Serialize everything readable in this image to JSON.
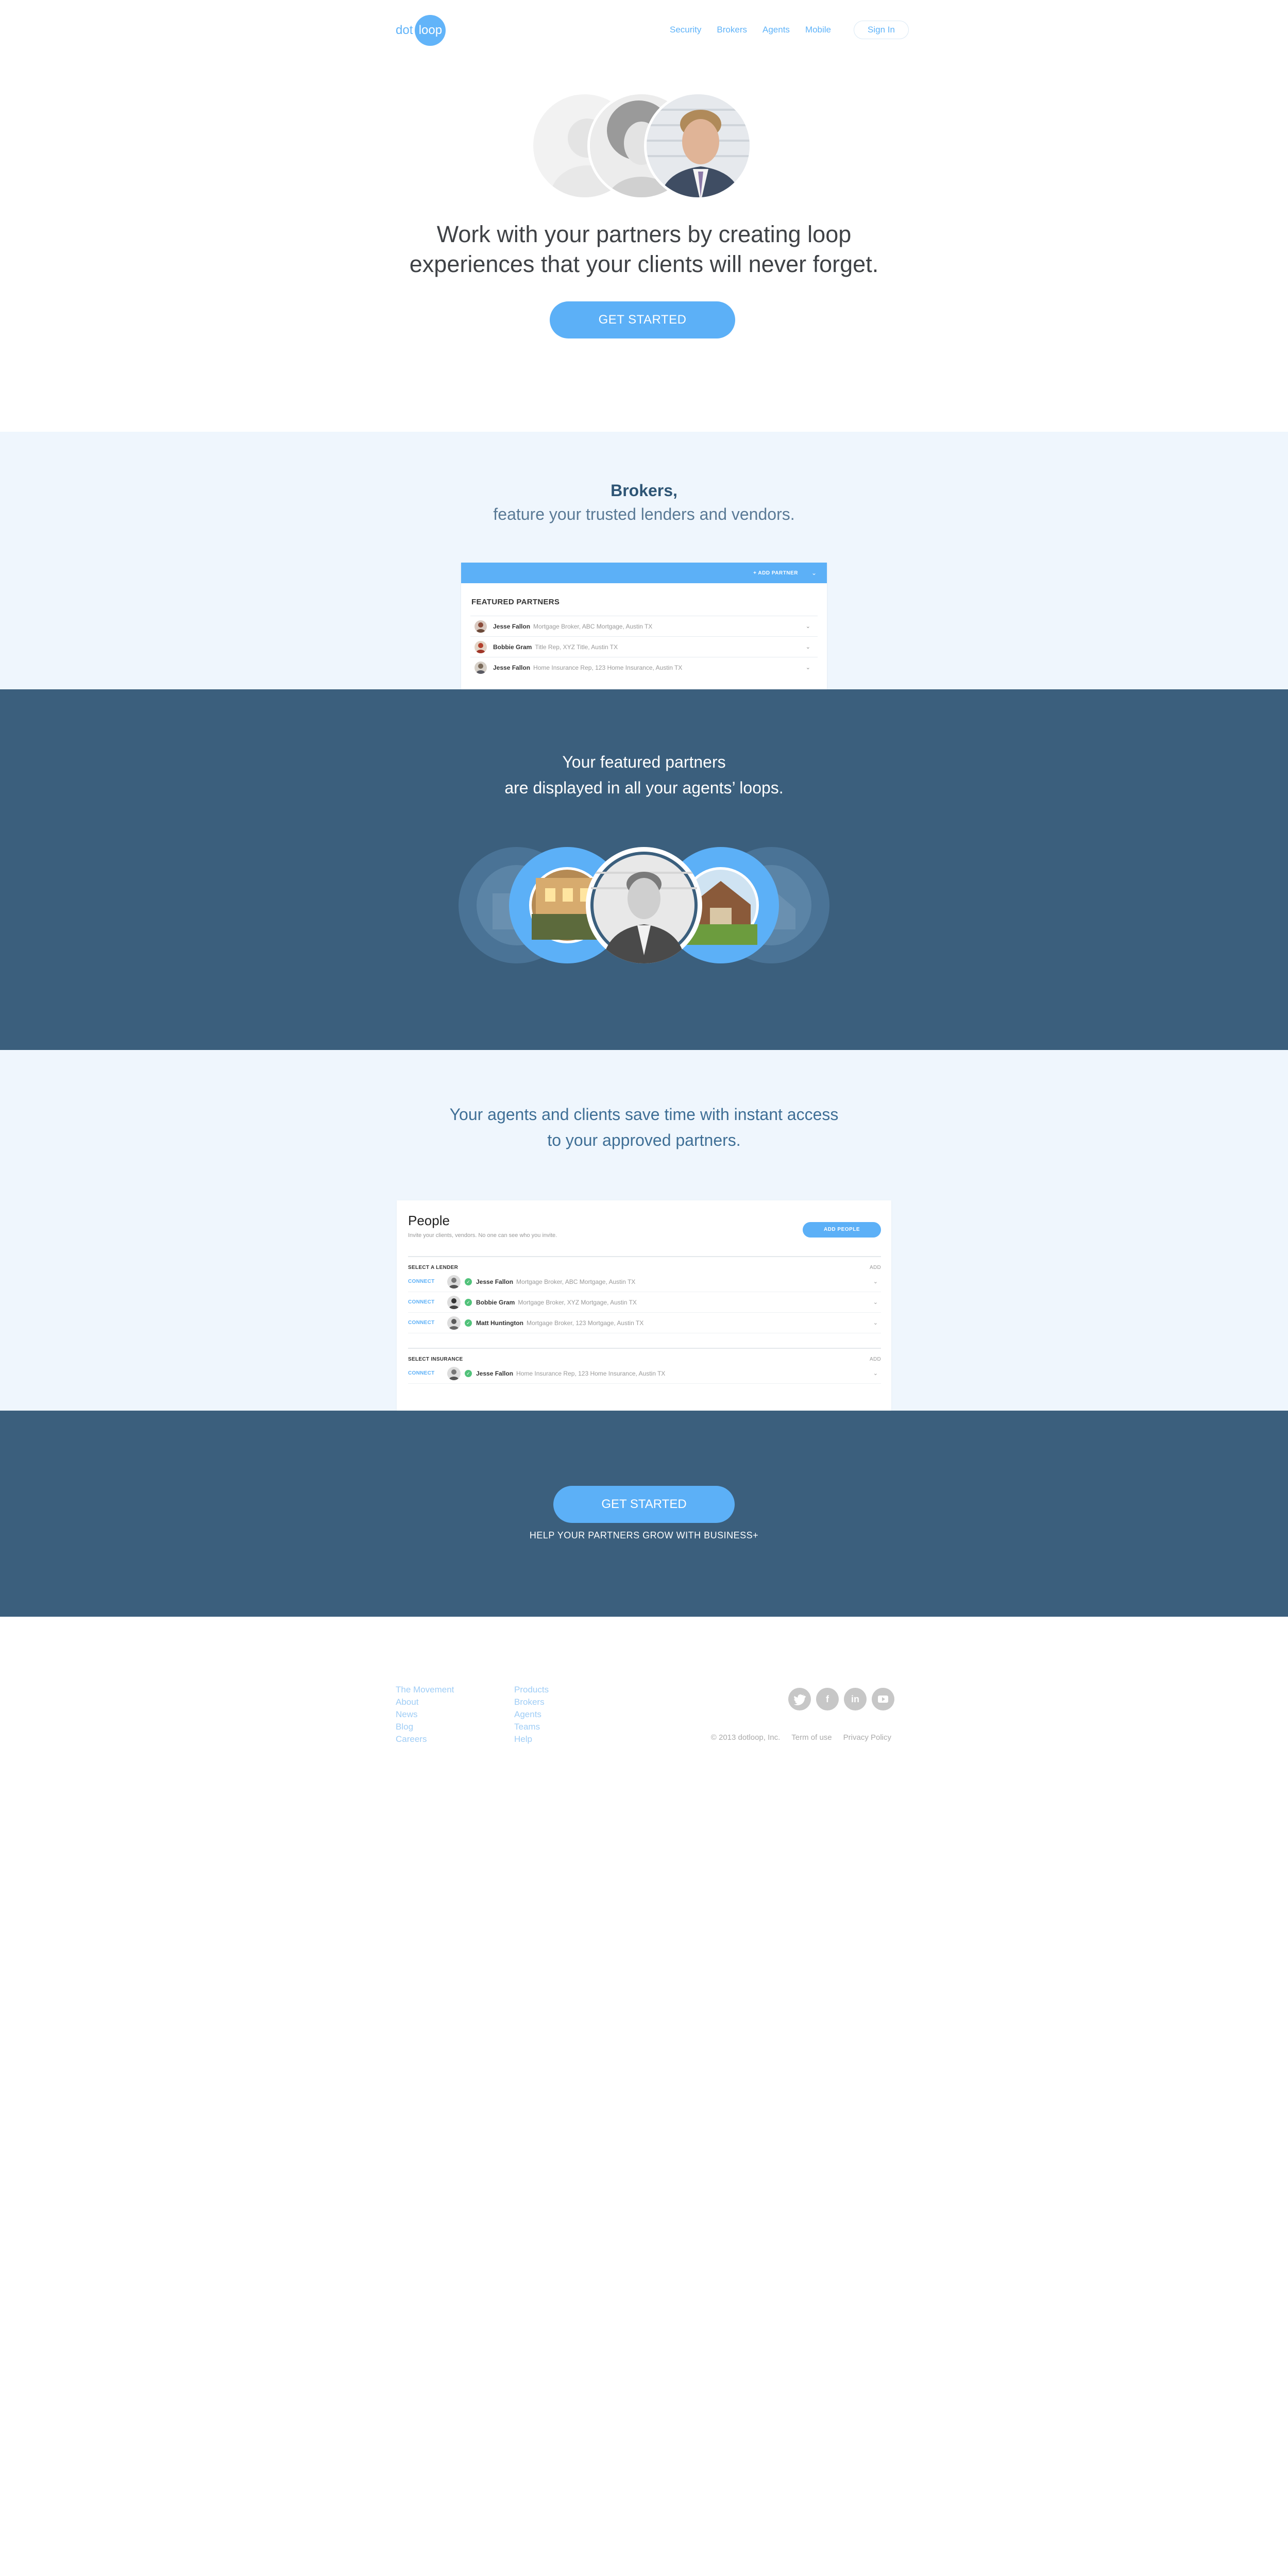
{
  "header": {
    "logo_dot": "dot",
    "logo_loop": "loop",
    "nav": [
      "Security",
      "Brokers",
      "Agents",
      "Mobile"
    ],
    "signin": "Sign In"
  },
  "hero": {
    "headline_line1": "Work with your partners by creating loop",
    "headline_line2": "experiences that your clients will never forget.",
    "cta": "GET STARTED"
  },
  "brokers": {
    "title": "Brokers,",
    "subtitle": "feature your trusted lenders and vendors.",
    "card": {
      "add_partner": "+ ADD PARTNER",
      "title": "FEATURED PARTNERS",
      "rows": [
        {
          "name": "Jesse Fallon",
          "desc": "Mortgage Broker, ABC Mortgage, Austin TX"
        },
        {
          "name": "Bobbie Gram",
          "desc": "Title Rep, XYZ Title, Austin TX"
        },
        {
          "name": "Jesse Fallon",
          "desc": "Home Insurance Rep, 123 Home Insurance, Austin TX"
        }
      ]
    }
  },
  "featured": {
    "line1": "Your featured partners",
    "line2": "are displayed in all your agents’ loops."
  },
  "agents": {
    "line1": "Your agents and clients save time with instant access",
    "line2": "to your approved partners.",
    "card": {
      "title": "People",
      "subtitle": "Invite your clients, vendors. No one can see who you invite.",
      "add_people": "ADD PEOPLE",
      "groups": [
        {
          "label": "SELECT A LENDER",
          "add": "ADD",
          "rows": [
            {
              "connect": "CONNECT",
              "name": "Jesse Fallon",
              "desc": "Mortgage Broker, ABC Mortgage, Austin TX"
            },
            {
              "connect": "CONNECT",
              "name": "Bobbie Gram",
              "desc": "Mortgage Broker, XYZ Mortgage, Austin TX"
            },
            {
              "connect": "CONNECT",
              "name": "Matt Huntington",
              "desc": "Mortgage Broker, 123 Mortgage, Austin TX"
            }
          ]
        },
        {
          "label": "SELECT INSURANCE",
          "add": "ADD",
          "rows": [
            {
              "connect": "CONNECT",
              "name": "Jesse Fallon",
              "desc": "Home Insurance Rep, 123 Home Insurance, Austin TX"
            }
          ]
        }
      ]
    }
  },
  "cta": {
    "button": "GET STARTED",
    "text": "HELP YOUR PARTNERS GROW WITH BUSINESS+"
  },
  "footer": {
    "col1": [
      "The Movement",
      "About",
      "News",
      "Blog",
      "Careers"
    ],
    "col2": [
      "Products",
      "Brokers",
      "Agents",
      "Teams",
      "Help"
    ],
    "socials": [
      "twitter-icon",
      "facebook-icon",
      "linkedin-icon",
      "youtube-icon"
    ],
    "copyright": "© 2013 dotloop, Inc.",
    "terms": "Term of use",
    "privacy": "Privacy Policy"
  },
  "colors": {
    "accent": "#5cb0f7",
    "dark_band": "#3b5f7d",
    "light_band": "#eff6fd"
  }
}
